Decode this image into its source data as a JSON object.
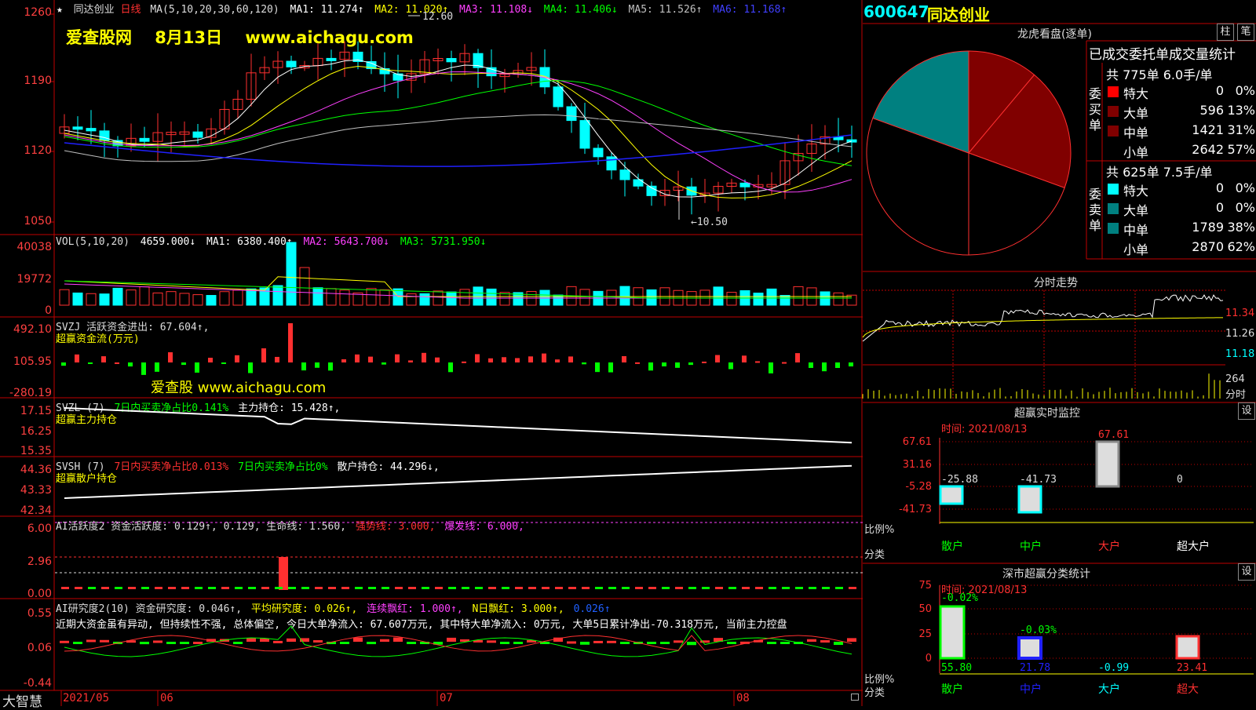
{
  "colors": {
    "up": "#ff3030",
    "down": "#00ffff",
    "grid": "#c00000",
    "green": "#00ff00",
    "yellow": "#ffff00",
    "magenta": "#ff40ff",
    "teal": "#008080",
    "darkred": "#800000",
    "white": "#ffffff",
    "blue": "#2020ff"
  },
  "main": {
    "star": "★",
    "stock_name": "同达创业",
    "period": "日线",
    "ma_params": "MA(5,10,20,30,60,120)",
    "ma1": "MA1: 11.274↑",
    "ma2": "MA2: 11.020↑",
    "ma3": "MA3: 11.108↓",
    "ma4": "MA4: 11.406↓",
    "ma5": "MA5: 11.526↑",
    "ma6": "MA6: 11.168↑",
    "watermark": "爱查股网    8月13日    www.aichagu.com",
    "high_mark": "12.60",
    "low_mark": "←10.50",
    "axis": [
      "1260",
      "1190",
      "1120",
      "1050"
    ]
  },
  "vol": {
    "label": "VOL(5,10,20)",
    "value": "4659.000↓",
    "ma1": "MA1: 6380.400↑",
    "ma2": "MA2: 5643.700↓",
    "ma3": "MA3: 5731.950↓",
    "axis": [
      "40038",
      "19772",
      "0"
    ]
  },
  "svzj": {
    "label": "SVZJ  活跃资金进出: 67.604↑,",
    "sub": "超赢资金流(万元)",
    "watermark": "爱查股  www.aichagu.com",
    "axis": [
      "492.10",
      "105.95",
      "-280.19"
    ]
  },
  "svzl": {
    "label": "SVZL (7)",
    "part2": "7日内买卖净占比0.141%",
    "part3": "主力持仓: 15.428↑,",
    "sub": "超赢主力持仓",
    "axis": [
      "17.15",
      "16.25",
      "15.35"
    ]
  },
  "svsh": {
    "label": "SVSH (7)",
    "part2": "7日内买卖净占比0.013%",
    "part3": "7日内买卖净占比0%",
    "part4": "散户持仓: 44.296↓,",
    "sub": "超赢散户持仓",
    "axis": [
      "44.36",
      "43.33",
      "42.34"
    ]
  },
  "ai1": {
    "label": "AI活跃度2 资金活跃度: 0.129↑, 0.129, 生命线: 1.560,",
    "strong": "强势线: 3.000,",
    "burst": "爆发线: 6.000,",
    "axis": [
      "6.00",
      "2.96",
      "0.00"
    ]
  },
  "ai2": {
    "label": "AI研究度2(10) 资金研究度: 0.046↑,",
    "avg": "平均研究度: 0.026↑,",
    "streak": "连续飘红: 1.000↑,",
    "nday": "N日飘红: 3.000↑,",
    "tail": "0.026↑",
    "comment": "近期大资金虽有异动, 但持续性不强, 总体偏空, 今日大单净流入: 67.607万元, 其中特大单净流入: 0万元, 大单5日累计净出-70.318万元, 当前主力控盘",
    "axis": [
      "0.55",
      "0.06",
      "-0.44"
    ]
  },
  "bottom": {
    "brand": "大智慧",
    "dates": [
      "2021/05",
      "06",
      "07",
      "08"
    ]
  },
  "right": {
    "code": "600647",
    "name": "同达创业",
    "dragon_title": "龙虎看盘(逐单)",
    "btn_zhu": "柱",
    "btn_bi": "笔",
    "table_title": "已成交委托单成交量统计",
    "buy": {
      "summary": "共 775单 6.0手/单",
      "side": "委买单",
      "rows": [
        {
          "name": "特大",
          "count": "0",
          "pct": "0%"
        },
        {
          "name": "大单",
          "count": "596",
          "pct": "13%"
        },
        {
          "name": "中单",
          "count": "1421",
          "pct": "31%"
        },
        {
          "name": "小单",
          "count": "2642",
          "pct": "57%"
        }
      ]
    },
    "sell": {
      "summary": "共 625单 7.5手/单",
      "side": "委卖单",
      "rows": [
        {
          "name": "特大",
          "count": "0",
          "pct": "0%"
        },
        {
          "name": "大单",
          "count": "0",
          "pct": "0%"
        },
        {
          "name": "中单",
          "count": "1789",
          "pct": "38%"
        },
        {
          "name": "小单",
          "count": "2870",
          "pct": "62%"
        }
      ]
    },
    "fenshi_title": "分时走势",
    "fenshi_axis": [
      "11.34",
      "11.26",
      "11.18"
    ],
    "fenshi_vol": [
      "264",
      "分时"
    ],
    "monitor": {
      "title": "超赢实时监控",
      "btn": "设",
      "time": "时间: 2021/08/13",
      "axis": [
        "67.61",
        "31.16",
        "-5.28",
        "-41.73"
      ],
      "ratio_label": "比例%",
      "class_label": "分类",
      "categories": [
        "散户",
        "中户",
        "大户",
        "超大户"
      ],
      "values": [
        "-25.88",
        "-41.73",
        "67.61",
        "0"
      ]
    },
    "stats": {
      "title": "深市超赢分类统计",
      "btn": "设",
      "time": "时间: 2021/08/13",
      "axis": [
        "75",
        "50",
        "25",
        "0"
      ],
      "ratio_label": "比例%",
      "class_label": "分类",
      "categories": [
        "散户",
        "中户",
        "大户",
        "超大"
      ],
      "top_labels": [
        "-0.02%",
        "-0.03%"
      ],
      "values": [
        "55.80",
        "21.78",
        "-0.99",
        "23.41"
      ]
    }
  }
}
